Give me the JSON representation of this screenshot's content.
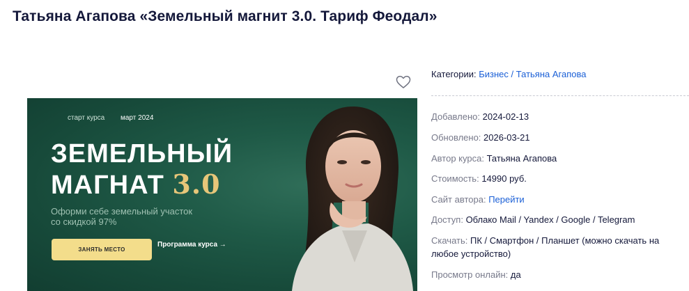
{
  "title": "Татьяна Агапова «Земельный магнит 3.0. Тариф Феодал»",
  "banner": {
    "start_label": "старт курса",
    "date": "март 2024",
    "title_line1": "ЗЕМЕЛЬНЫЙ",
    "title_line2": "МАГНАТ",
    "version": "3.0",
    "subtitle": "Оформи себе земельный участок со скидкой 97%",
    "button": "ЗАНЯТЬ МЕСТО",
    "program_link": "Программа курса →"
  },
  "info": {
    "categories_label": "Категории:",
    "categories": [
      "Бизнес",
      "Татьяна Агапова"
    ],
    "category_separator": "/",
    "added_label": "Добавлено:",
    "added": "2024-02-13",
    "updated_label": "Обновлено:",
    "updated": "2026-03-21",
    "author_label": "Автор курса:",
    "author": "Татьяна Агапова",
    "price_label": "Стоимость:",
    "price": "14990 руб.",
    "site_label": "Сайт автора:",
    "site_link": "Перейти",
    "access_label": "Доступ:",
    "access": "Облако Mail / Yandex / Google / Telegram",
    "download_label": "Скачать:",
    "download": "ПК / Смартфон / Планшет (можно скачать на любое устройство)",
    "online_label": "Просмотр онлайн:",
    "online": "да"
  },
  "colors": {
    "title": "#14183a",
    "link": "#1a5fd6",
    "label": "#77798a",
    "banner_bg": "#1f5a47",
    "banner_button": "#f3dd8b",
    "banner_accent": "#e7c679"
  }
}
